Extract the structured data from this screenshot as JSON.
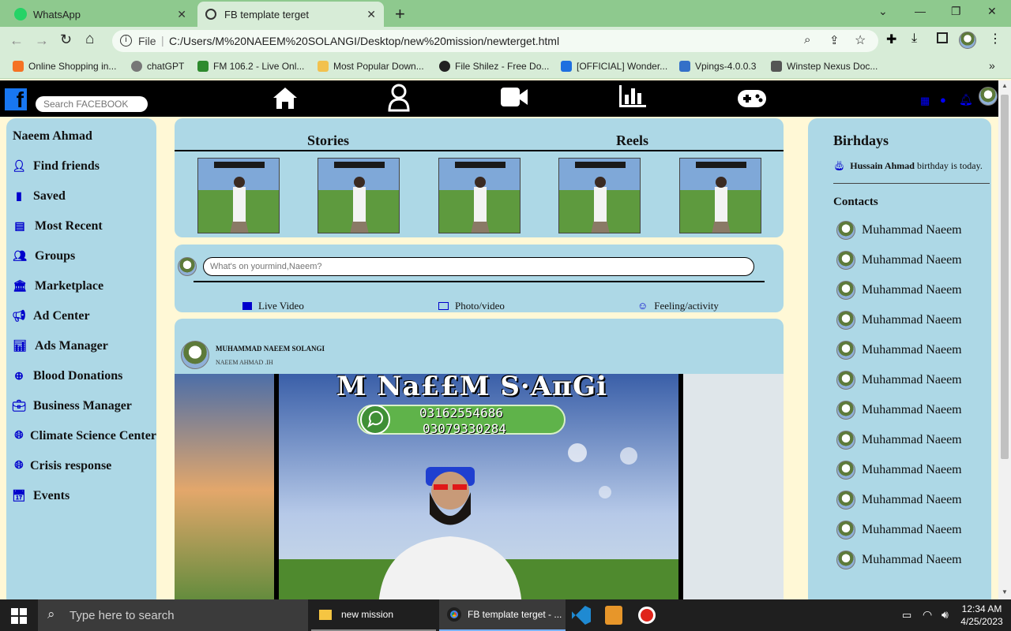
{
  "browser": {
    "tabs": [
      {
        "label": "WhatsApp"
      },
      {
        "label": "FB template terget"
      }
    ],
    "new_tab": "+",
    "address_scheme": "File",
    "address_url": "C:/Users/M%20NAEEM%20SOLANGI/Desktop/new%20mission/newterget.html",
    "bookmarks": [
      {
        "label": "Online Shopping in..."
      },
      {
        "label": "chatGPT"
      },
      {
        "label": "FM 106.2 - Live Onl..."
      },
      {
        "label": "Most Popular Down..."
      },
      {
        "label": "File Shilez - Free Do..."
      },
      {
        "label": "[OFFICIAL] Wonder..."
      },
      {
        "label": "Vpings-4.0.0.3"
      },
      {
        "label": "Winstep Nexus Doc..."
      }
    ]
  },
  "fb": {
    "search_placeholder": "Search FACEBOOK",
    "colors": {
      "nav_bg": "#000000",
      "panel_bg": "#add8e6",
      "page_bg": "#fff8d6",
      "icon_blue": "#0000cc"
    },
    "left_nav": {
      "profile_name": "Naeem Ahmad",
      "items": [
        {
          "label": "Find friends",
          "icon": "user-icon"
        },
        {
          "label": "Saved",
          "icon": "bookmark-icon"
        },
        {
          "label": "Most Recent",
          "icon": "list-icon"
        },
        {
          "label": "Groups",
          "icon": "users-icon"
        },
        {
          "label": "Marketplace",
          "icon": "bank-icon"
        },
        {
          "label": "Ad Center",
          "icon": "megaphone-icon"
        },
        {
          "label": "Ads Manager",
          "icon": "chart-icon"
        },
        {
          "label": "Blood Donations",
          "icon": "plus-circle-icon"
        },
        {
          "label": "Business Manager",
          "icon": "briefcase-icon"
        },
        {
          "label": "Climate Science Center",
          "icon": "globe-icon"
        },
        {
          "label": "Crisis response",
          "icon": "globe-icon"
        },
        {
          "label": "Events",
          "icon": "calendar-icon"
        }
      ]
    },
    "stories": {
      "stories_label": "Stories",
      "reels_label": "Reels"
    },
    "composer": {
      "placeholder": "What's on yourmind,Naeem?",
      "live": "Live Video",
      "photo": "Photo/video",
      "feeling": "Feeling/activity"
    },
    "post": {
      "author": "MUHAMMAD NAEEM SOLANGI",
      "subtitle": "NAEEM AHMAD .IH",
      "banner_title": "M Na££M S·ΑπGi",
      "phone1": "03162554686",
      "phone2": "03079330284"
    },
    "right": {
      "birthdays_title": "Birhdays",
      "birthday_name": "Hussain Ahmad",
      "birthday_text": " birthday is today.",
      "contacts_title": "Contacts",
      "contacts": [
        "Muhammad Naeem",
        "Muhammad Naeem",
        "Muhammad Naeem",
        "Muhammad Naeem",
        "Muhammad Naeem",
        "Muhammad Naeem",
        "Muhammad Naeem",
        "Muhammad Naeem",
        "Muhammad Naeem",
        "Muhammad Naeem",
        "Muhammad Naeem",
        "Muhammad Naeem"
      ]
    }
  },
  "taskbar": {
    "search_placeholder": "Type here to search",
    "apps": [
      {
        "label": "new mission"
      },
      {
        "label": "FB template terget - ..."
      }
    ],
    "time": "12:34 AM",
    "date": "4/25/2023"
  }
}
